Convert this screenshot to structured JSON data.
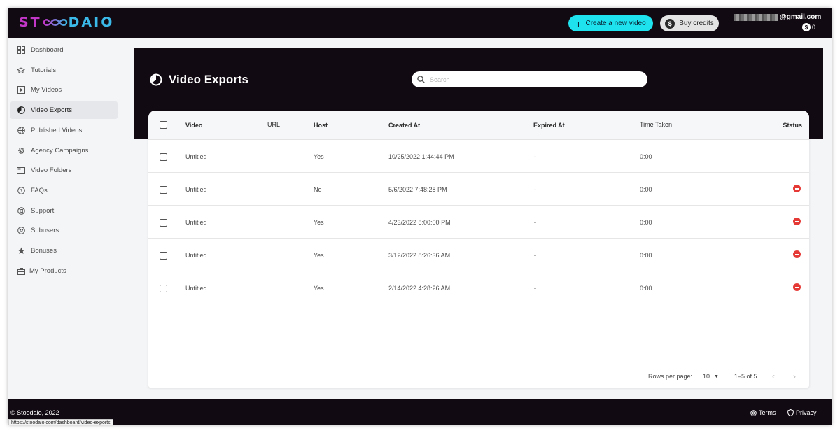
{
  "brand": {
    "logo_left": "ST",
    "logo_right": "DAIO",
    "colors": {
      "magenta": "#c236c8",
      "cyan": "#3bb9e8",
      "accent": "#1ee3ee",
      "dark": "#120a12",
      "danger": "#e53935"
    }
  },
  "header": {
    "create_label": "Create a new video",
    "credits_label": "Buy credits",
    "email_suffix": "@gmail.com",
    "credit_count": "0"
  },
  "sidebar": {
    "items": [
      {
        "label": "Dashboard",
        "icon": "dashboard-icon"
      },
      {
        "label": "Tutorials",
        "icon": "graduation-cap-icon"
      },
      {
        "label": "My Videos",
        "icon": "video-play-icon"
      },
      {
        "label": "Video Exports",
        "icon": "export-pie-icon",
        "active": true
      },
      {
        "label": "Published Videos",
        "icon": "globe-icon"
      },
      {
        "label": "Agency Campaigns",
        "icon": "gear-icon"
      },
      {
        "label": "Video Folders",
        "icon": "folder-window-icon"
      },
      {
        "label": "FAQs",
        "icon": "question-icon"
      },
      {
        "label": "Support",
        "icon": "lifebuoy-icon"
      },
      {
        "label": "Subusers",
        "icon": "users-icon"
      },
      {
        "label": "Bonuses",
        "icon": "star-icon"
      },
      {
        "label": "My Products",
        "icon": "briefcase-icon"
      }
    ]
  },
  "main": {
    "title": "Video Exports",
    "search_placeholder": "Search",
    "columns": [
      "Video",
      "URL",
      "Host",
      "Created At",
      "Expired At",
      "Time Taken",
      "Status"
    ],
    "rows": [
      {
        "video": "Untitled",
        "url": "",
        "host": "Yes",
        "created": "10/25/2022 1:44:44 PM",
        "expired": "-",
        "time": "0:00",
        "status": ""
      },
      {
        "video": "Untitled",
        "url": "",
        "host": "No",
        "created": "5/6/2022 7:48:28 PM",
        "expired": "-",
        "time": "0:00",
        "status": "failed"
      },
      {
        "video": "Untitled",
        "url": "",
        "host": "Yes",
        "created": "4/23/2022 8:00:00 PM",
        "expired": "-",
        "time": "0:00",
        "status": "failed"
      },
      {
        "video": "Untitled",
        "url": "",
        "host": "Yes",
        "created": "3/12/2022 8:26:36 AM",
        "expired": "-",
        "time": "0:00",
        "status": "failed"
      },
      {
        "video": "Untitled",
        "url": "",
        "host": "Yes",
        "created": "2/14/2022 4:28:26 AM",
        "expired": "-",
        "time": "0:00",
        "status": "failed"
      }
    ],
    "pagination": {
      "rows_per_page_label": "Rows per page:",
      "rows_per_page": "10",
      "range": "1–5 of 5"
    }
  },
  "footer": {
    "copyright": "© Stoodaio, 2022",
    "terms": "Terms",
    "privacy": "Privacy"
  },
  "status_bar_url": "https://stoodaio.com/dashboard/video-exports"
}
